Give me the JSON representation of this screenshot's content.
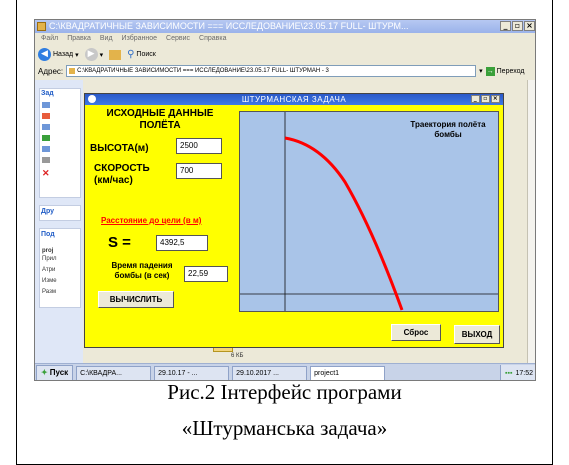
{
  "explorer": {
    "title": "C:\\КВАДРАТИЧНЫЕ ЗАВИСИМОСТИ === ИССЛЕДОВАНИЕ\\23.05.17 FULL- ШТУРМ...",
    "menu": [
      "Файл",
      "Правка",
      "Вид",
      "Избранное",
      "Сервис",
      "Справка"
    ],
    "toolbar": {
      "back": "Назад",
      "search": "Поиск"
    },
    "address_label": "Адрес:",
    "address_value": "C:\\КВАДРАТИЧНЫЕ ЗАВИСИМОСТИ === ИССЛЕДОВАНИЕ\\23.05.17 FULL- ШТУРМАН - 3",
    "go_label": "Переход",
    "side_heads": [
      "Зад",
      "Дру",
      "Под"
    ],
    "side_details": [
      "proj",
      "Прил",
      "Атри",
      "Изме",
      "Разм"
    ],
    "file_size": "6 КБ"
  },
  "app": {
    "title": "ШТУРМАНСКАЯ ЗАДАЧА",
    "section_title": "ИСХОДНЫЕ ДАННЫЕ ПОЛЁТА",
    "height_label": "ВЫСОТА(м)",
    "height_value": "2500",
    "speed_label": "СКОРОСТЬ (км/час)",
    "speed_value": "700",
    "distance_label": "Расстояние до цели (в м)",
    "s_label": "S =",
    "s_value": "4392,5",
    "time_label": "Время падения бомбы (в сек)",
    "time_value": "22,59",
    "compute_button": "ВЫЧИСЛИТЬ",
    "plot_label": "Траектория полёта бомбы",
    "reset_button": "Сброс",
    "exit_button": "ВЫХОД",
    "colors": {
      "window": "#ffff00",
      "plot_bg": "#a9c4e8",
      "trajectory": "#ff0000",
      "distance_label": "#ff0000"
    }
  },
  "taskbar": {
    "start": "Пуск",
    "tasks": [
      "C:\\КВАДРА...",
      "29.10.17 - ...",
      "29.10.2017 ...",
      "project1"
    ],
    "clock": "17:52"
  },
  "caption": {
    "line1": "Рис.2 Інтерфейс програми",
    "line2": "«Штурманська  задача»"
  }
}
